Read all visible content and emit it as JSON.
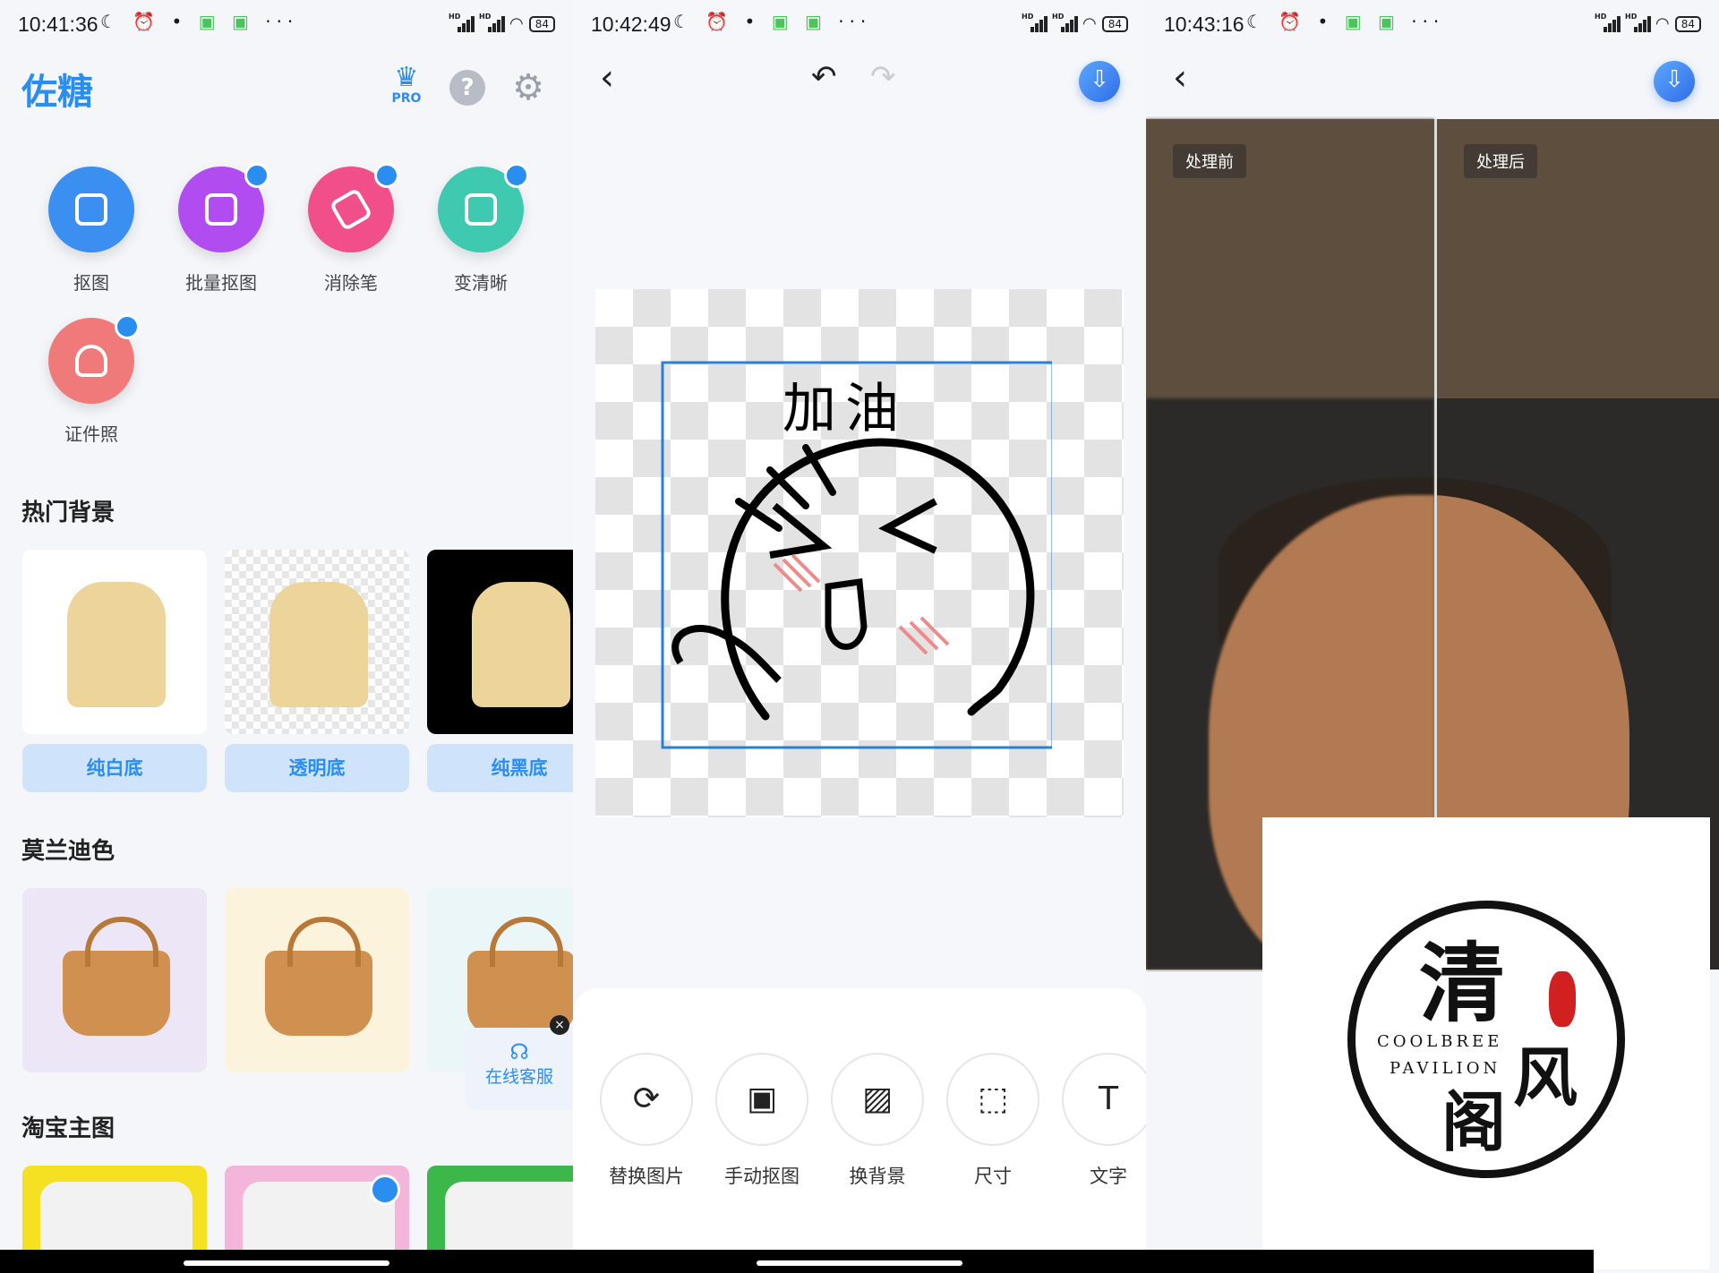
{
  "panel1": {
    "status": {
      "time": "10:41:36",
      "battery": "84"
    },
    "app_title": "佐糖",
    "pro_label": "PRO",
    "tools": [
      {
        "label": "抠图",
        "color": "#3a8ff0",
        "crown": false
      },
      {
        "label": "批量抠图",
        "color": "#b04cf0",
        "crown": true
      },
      {
        "label": "消除笔",
        "color": "#f04f8a",
        "crown": true
      },
      {
        "label": "变清晰",
        "color": "#3fc9b0",
        "crown": true
      },
      {
        "label": "证件照",
        "color": "#f07a7a",
        "crown": true
      }
    ],
    "sections": {
      "hot_bg": "热门背景",
      "morandi": "莫兰迪色",
      "taobao": "淘宝主图"
    },
    "bg_options": [
      "纯白底",
      "透明底",
      "纯黑底"
    ],
    "customer_service": "在线客服"
  },
  "panel2": {
    "status": {
      "time": "10:42:49",
      "battery": "84"
    },
    "sticker_text": "加油",
    "tools": [
      "替换图片",
      "手动抠图",
      "换背景",
      "尺寸",
      "文字"
    ]
  },
  "panel3": {
    "status": {
      "time": "10:43:16",
      "battery": "84"
    },
    "before_label": "处理前",
    "after_label": "处理后",
    "watermark": {
      "ch1": "清",
      "ch2": "风",
      "ch3": "阁",
      "en1": "COOLBREE",
      "en2": "PAVILION"
    }
  },
  "colors": {
    "accent": "#2a8ef0",
    "pill_bg": "#cfe4fb"
  }
}
